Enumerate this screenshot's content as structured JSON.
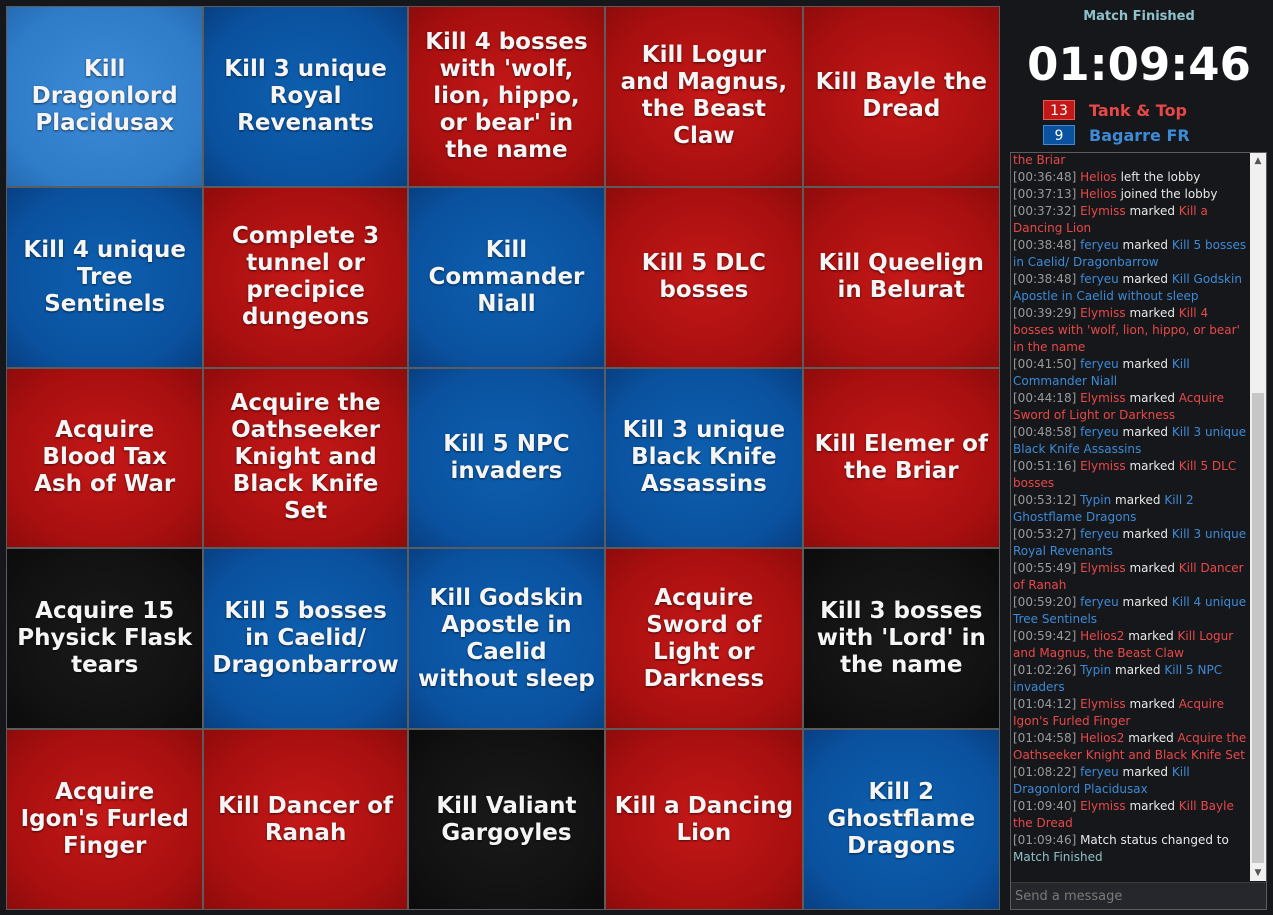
{
  "board": {
    "cells": [
      {
        "text": "Kill Dragonlord Placidusax",
        "color": "selected"
      },
      {
        "text": "Kill 3 unique Royal Revenants",
        "color": "blue"
      },
      {
        "text": "Kill 4 bosses with 'wolf, lion, hippo, or bear' in the name",
        "color": "red"
      },
      {
        "text": "Kill Logur and Magnus, the Beast Claw",
        "color": "red"
      },
      {
        "text": "Kill Bayle the Dread",
        "color": "red"
      },
      {
        "text": "Kill 4 unique Tree Sentinels",
        "color": "blue"
      },
      {
        "text": "Complete 3 tunnel or precipice dungeons",
        "color": "red"
      },
      {
        "text": "Kill Commander Niall",
        "color": "blue"
      },
      {
        "text": "Kill 5 DLC bosses",
        "color": "red"
      },
      {
        "text": "Kill Queelign in Belurat",
        "color": "red"
      },
      {
        "text": "Acquire Blood Tax Ash of War",
        "color": "red"
      },
      {
        "text": "Acquire the Oathseeker Knight and Black Knife Set",
        "color": "red"
      },
      {
        "text": "Kill 5 NPC invaders",
        "color": "blue"
      },
      {
        "text": "Kill 3 unique Black Knife Assassins",
        "color": "blue"
      },
      {
        "text": "Kill Elemer of the Briar",
        "color": "red"
      },
      {
        "text": "Acquire 15 Physick Flask tears",
        "color": "black"
      },
      {
        "text": "Kill 5 bosses in Caelid/ Dragonbarrow",
        "color": "blue"
      },
      {
        "text": "Kill Godskin Apostle in Caelid without sleep",
        "color": "blue"
      },
      {
        "text": "Acquire Sword of Light or Darkness",
        "color": "red"
      },
      {
        "text": "Kill 3 bosses with 'Lord' in the name",
        "color": "black"
      },
      {
        "text": "Acquire Igon's Furled Finger",
        "color": "red"
      },
      {
        "text": "Kill Dancer of Ranah",
        "color": "red"
      },
      {
        "text": "Kill Valiant Gargoyles",
        "color": "black"
      },
      {
        "text": "Kill a Dancing Lion",
        "color": "red"
      },
      {
        "text": "Kill 2 Ghostflame Dragons",
        "color": "blue"
      }
    ]
  },
  "status": "Match Finished",
  "timer": "01:09:46",
  "teams": [
    {
      "score": "13",
      "name": "Tank & Top",
      "color": "#c41818"
    },
    {
      "score": "9",
      "name": "Bagarre FR",
      "color": "#0a52a0"
    }
  ],
  "chat": {
    "messages": [
      {
        "parts": [
          {
            "t": "the Briar",
            "c": "r"
          }
        ]
      },
      {
        "parts": [
          {
            "t": "[00:36:48] ",
            "c": "ts"
          },
          {
            "t": "Helios",
            "c": "r"
          },
          {
            "t": " left the lobby",
            "c": "w"
          }
        ]
      },
      {
        "parts": [
          {
            "t": "[00:37:13] ",
            "c": "ts"
          },
          {
            "t": "Helios",
            "c": "r"
          },
          {
            "t": " joined the lobby",
            "c": "w"
          }
        ]
      },
      {
        "parts": [
          {
            "t": "[00:37:32] ",
            "c": "ts"
          },
          {
            "t": "Elymiss",
            "c": "r"
          },
          {
            "t": " marked ",
            "c": "w"
          },
          {
            "t": "Kill a Dancing Lion",
            "c": "r"
          }
        ]
      },
      {
        "parts": [
          {
            "t": "[00:38:48] ",
            "c": "ts"
          },
          {
            "t": "feryeu",
            "c": "b"
          },
          {
            "t": " marked ",
            "c": "w"
          },
          {
            "t": "Kill 5 bosses in Caelid/ Dragonbarrow",
            "c": "b"
          }
        ]
      },
      {
        "parts": [
          {
            "t": "[00:38:48] ",
            "c": "ts"
          },
          {
            "t": "feryeu",
            "c": "b"
          },
          {
            "t": " marked ",
            "c": "w"
          },
          {
            "t": "Kill Godskin Apostle in Caelid without sleep",
            "c": "b"
          }
        ]
      },
      {
        "parts": [
          {
            "t": "[00:39:29] ",
            "c": "ts"
          },
          {
            "t": "Elymiss",
            "c": "r"
          },
          {
            "t": " marked ",
            "c": "w"
          },
          {
            "t": "Kill 4 bosses with 'wolf, lion, hippo, or bear' in the name",
            "c": "r"
          }
        ]
      },
      {
        "parts": [
          {
            "t": "[00:41:50] ",
            "c": "ts"
          },
          {
            "t": "feryeu",
            "c": "b"
          },
          {
            "t": " marked ",
            "c": "w"
          },
          {
            "t": "Kill Commander Niall",
            "c": "b"
          }
        ]
      },
      {
        "parts": [
          {
            "t": "[00:44:18] ",
            "c": "ts"
          },
          {
            "t": "Elymiss",
            "c": "r"
          },
          {
            "t": " marked ",
            "c": "w"
          },
          {
            "t": "Acquire Sword of Light or Darkness",
            "c": "r"
          }
        ]
      },
      {
        "parts": [
          {
            "t": "[00:48:58] ",
            "c": "ts"
          },
          {
            "t": "feryeu",
            "c": "b"
          },
          {
            "t": " marked ",
            "c": "w"
          },
          {
            "t": "Kill 3 unique Black Knife Assassins",
            "c": "b"
          }
        ]
      },
      {
        "parts": [
          {
            "t": "[00:51:16] ",
            "c": "ts"
          },
          {
            "t": "Elymiss",
            "c": "r"
          },
          {
            "t": " marked ",
            "c": "w"
          },
          {
            "t": "Kill 5 DLC bosses",
            "c": "r"
          }
        ]
      },
      {
        "parts": [
          {
            "t": "[00:53:12] ",
            "c": "ts"
          },
          {
            "t": "Typin",
            "c": "b"
          },
          {
            "t": " marked ",
            "c": "w"
          },
          {
            "t": "Kill 2 Ghostflame Dragons",
            "c": "b"
          }
        ]
      },
      {
        "parts": [
          {
            "t": "[00:53:27] ",
            "c": "ts"
          },
          {
            "t": "feryeu",
            "c": "b"
          },
          {
            "t": " marked ",
            "c": "w"
          },
          {
            "t": "Kill 3 unique Royal Revenants",
            "c": "b"
          }
        ]
      },
      {
        "parts": [
          {
            "t": "[00:55:49] ",
            "c": "ts"
          },
          {
            "t": "Elymiss",
            "c": "r"
          },
          {
            "t": " marked ",
            "c": "w"
          },
          {
            "t": "Kill Dancer of Ranah",
            "c": "r"
          }
        ]
      },
      {
        "parts": [
          {
            "t": "[00:59:20] ",
            "c": "ts"
          },
          {
            "t": "feryeu",
            "c": "b"
          },
          {
            "t": " marked ",
            "c": "w"
          },
          {
            "t": "Kill 4 unique Tree Sentinels",
            "c": "b"
          }
        ]
      },
      {
        "parts": [
          {
            "t": "[00:59:42] ",
            "c": "ts"
          },
          {
            "t": "Helios2",
            "c": "r"
          },
          {
            "t": " marked ",
            "c": "w"
          },
          {
            "t": "Kill Logur and Magnus, the Beast Claw",
            "c": "r"
          }
        ]
      },
      {
        "parts": [
          {
            "t": "[01:02:26] ",
            "c": "ts"
          },
          {
            "t": "Typin",
            "c": "b"
          },
          {
            "t": " marked ",
            "c": "w"
          },
          {
            "t": "Kill 5 NPC invaders",
            "c": "b"
          }
        ]
      },
      {
        "parts": [
          {
            "t": "[01:04:12] ",
            "c": "ts"
          },
          {
            "t": "Elymiss",
            "c": "r"
          },
          {
            "t": " marked ",
            "c": "w"
          },
          {
            "t": "Acquire Igon's Furled Finger",
            "c": "r"
          }
        ]
      },
      {
        "parts": [
          {
            "t": "[01:04:58] ",
            "c": "ts"
          },
          {
            "t": "Helios2",
            "c": "r"
          },
          {
            "t": " marked ",
            "c": "w"
          },
          {
            "t": "Acquire the Oathseeker Knight and Black Knife Set",
            "c": "r"
          }
        ]
      },
      {
        "parts": [
          {
            "t": "[01:08:22] ",
            "c": "ts"
          },
          {
            "t": "feryeu",
            "c": "b"
          },
          {
            "t": " marked ",
            "c": "w"
          },
          {
            "t": "Kill Dragonlord Placidusax",
            "c": "b"
          }
        ]
      },
      {
        "parts": [
          {
            "t": "[01:09:40] ",
            "c": "ts"
          },
          {
            "t": "Elymiss",
            "c": "r"
          },
          {
            "t": " marked ",
            "c": "w"
          },
          {
            "t": "Kill Bayle the Dread",
            "c": "r"
          }
        ]
      },
      {
        "parts": [
          {
            "t": "[01:09:46] ",
            "c": "ts"
          },
          {
            "t": "Match status changed to ",
            "c": "w"
          },
          {
            "t": "Match Finished",
            "c": "g"
          }
        ]
      }
    ],
    "input_placeholder": "Send a message",
    "scroll_up_glyph": "▲",
    "scroll_down_glyph": "▼"
  }
}
